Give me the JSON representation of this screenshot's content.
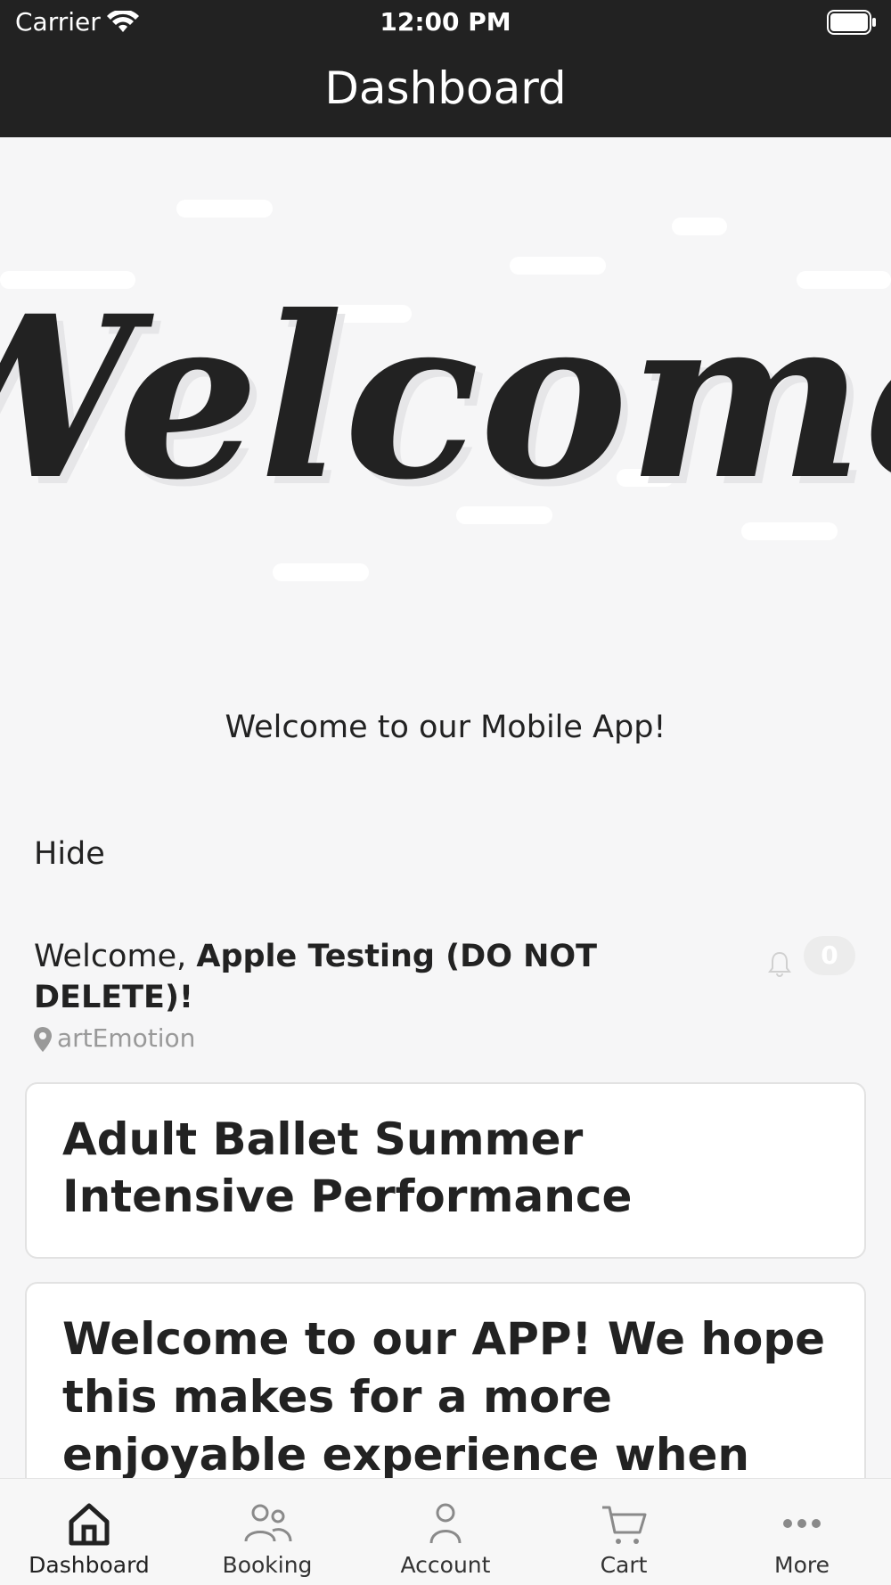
{
  "status_bar": {
    "carrier": "Carrier",
    "time": "12:00 PM"
  },
  "nav": {
    "title": "Dashboard"
  },
  "banner": {
    "image_text": "Welcome"
  },
  "welcome_subtitle": "Welcome to our Mobile App!",
  "hide_label": "Hide",
  "greeting": {
    "prefix": "Welcome, ",
    "name": "Apple Testing (DO NOT DELETE)!",
    "location": "artEmotion",
    "notification_count": "0"
  },
  "cards": [
    {
      "text": "Adult Ballet Summer Intensive Performance"
    },
    {
      "text": "Welcome to our APP! We hope this makes for a more enjoyable experience when registering"
    }
  ],
  "tabs": [
    {
      "label": "Dashboard",
      "icon": "home-icon",
      "active": true
    },
    {
      "label": "Booking",
      "icon": "people-icon",
      "active": false
    },
    {
      "label": "Account",
      "icon": "person-icon",
      "active": false
    },
    {
      "label": "Cart",
      "icon": "cart-icon",
      "active": false
    },
    {
      "label": "More",
      "icon": "more-icon",
      "active": false
    }
  ],
  "colors": {
    "header_bg": "#222222",
    "page_bg": "#f6f6f7",
    "muted_text": "#999999"
  }
}
